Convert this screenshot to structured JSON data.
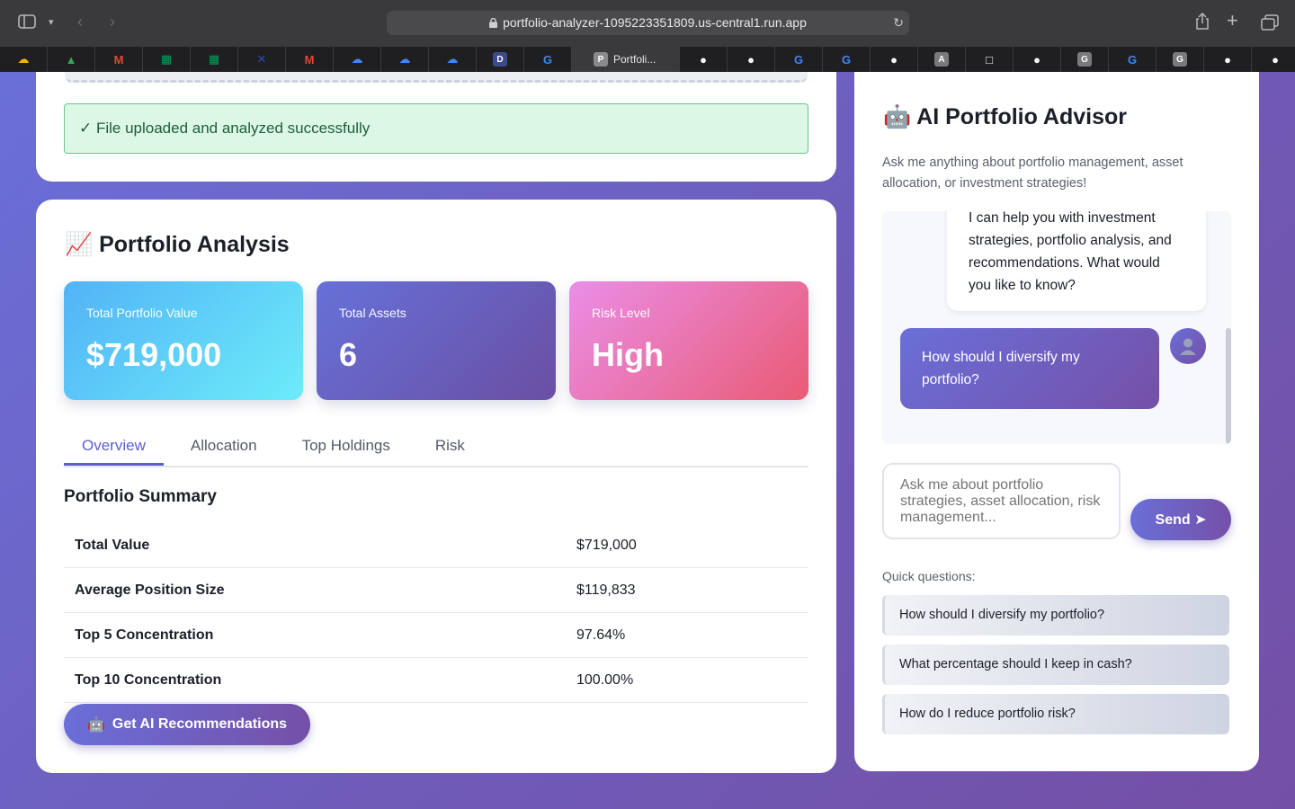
{
  "browser": {
    "url": "portfolio-analyzer-1095223351809.us-central1.run.app",
    "active_tab_label": "Portfoli...",
    "tabs": [
      {
        "icon": "google-cloud-icon",
        "color": "#f4b400"
      },
      {
        "icon": "google-drive-icon",
        "color": "#34a853"
      },
      {
        "icon": "gmail-icon",
        "color": "#ea4335"
      },
      {
        "icon": "google-sheets-icon",
        "color": "#0f9d58"
      },
      {
        "icon": "google-sheets-icon",
        "color": "#0f9d58"
      },
      {
        "icon": "x-icon",
        "color": "#2a4db8"
      },
      {
        "icon": "gmail-icon",
        "color": "#ea4335"
      },
      {
        "icon": "google-cloud-icon",
        "color": "#4285f4"
      },
      {
        "icon": "google-cloud-icon",
        "color": "#4285f4"
      },
      {
        "icon": "google-cloud-icon",
        "color": "#4285f4"
      },
      {
        "icon": "d-icon",
        "color": "#3b4a8c"
      },
      {
        "icon": "google-icon",
        "color": "#4285f4"
      },
      {
        "icon": "active",
        "color": "#8a8a8e"
      },
      {
        "icon": "github-icon",
        "color": "#ffffff"
      },
      {
        "icon": "github-icon",
        "color": "#ffffff"
      },
      {
        "icon": "google-icon",
        "color": "#4285f4"
      },
      {
        "icon": "google-icon",
        "color": "#4285f4"
      },
      {
        "icon": "github-icon",
        "color": "#ffffff"
      },
      {
        "icon": "a-icon",
        "color": "#7a7a7e"
      },
      {
        "icon": "square-icon",
        "color": "#ffffff"
      },
      {
        "icon": "github-icon",
        "color": "#ffffff"
      },
      {
        "icon": "g-icon",
        "color": "#7a7a7e"
      },
      {
        "icon": "google-icon",
        "color": "#4285f4"
      },
      {
        "icon": "g-icon",
        "color": "#7a7a7e"
      },
      {
        "icon": "github-icon",
        "color": "#ffffff"
      },
      {
        "icon": "github-icon",
        "color": "#ffffff"
      }
    ]
  },
  "upload": {
    "success_message": "✓ File uploaded and analyzed successfully"
  },
  "analysis": {
    "title": "Portfolio Analysis",
    "title_emoji": "📈",
    "stats": [
      {
        "label": "Total Portfolio Value",
        "value": "$719,000"
      },
      {
        "label": "Total Assets",
        "value": "6"
      },
      {
        "label": "Risk Level",
        "value": "High"
      }
    ],
    "tabs": [
      "Overview",
      "Allocation",
      "Top Holdings",
      "Risk"
    ],
    "active_tab": "Overview",
    "summary_title": "Portfolio Summary",
    "summary_rows": [
      {
        "key": "Total Value",
        "value": "$719,000"
      },
      {
        "key": "Average Position Size",
        "value": "$119,833"
      },
      {
        "key": "Top 5 Concentration",
        "value": "97.64%"
      },
      {
        "key": "Top 10 Concentration",
        "value": "100.00%"
      }
    ],
    "ai_button_label": "Get AI Recommendations",
    "ai_button_emoji": "🤖"
  },
  "advisor": {
    "title": "AI Portfolio Advisor",
    "title_emoji": "🤖",
    "subtitle": "Ask me anything about portfolio management, asset allocation, or investment strategies!",
    "bot_message": "I can help you with investment strategies, portfolio analysis, and recommendations. What would you like to know?",
    "user_message": "How should I diversify my portfolio?",
    "input_placeholder": "Ask me about portfolio strategies, asset allocation, risk management...",
    "send_label": "Send ➤",
    "quick_label": "Quick questions:",
    "quick_questions": [
      "How should I diversify my portfolio?",
      "What percentage should I keep in cash?",
      "How do I reduce portfolio risk?"
    ]
  },
  "colors": {
    "accent": "#5b5fd0",
    "gradient_start": "#6a6fd8",
    "gradient_end": "#7550a8",
    "success_bg": "#dcf7e6"
  }
}
